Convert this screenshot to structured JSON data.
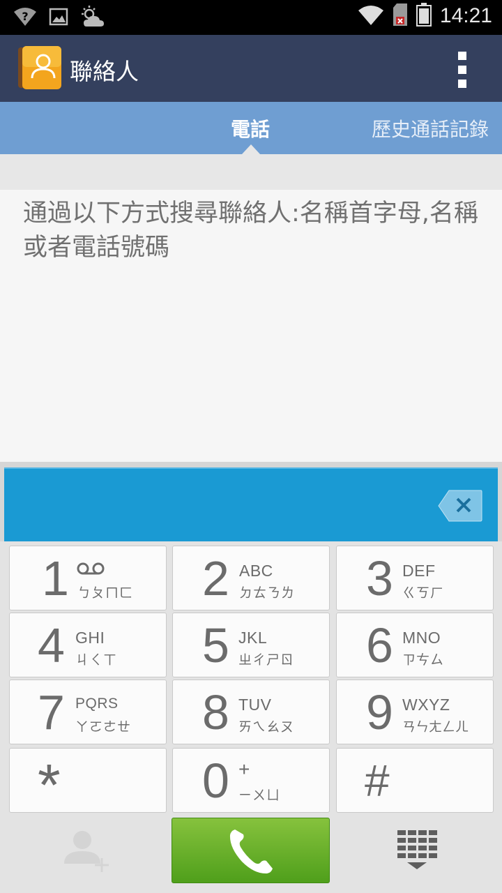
{
  "status_bar": {
    "time": "14:21",
    "icons": [
      "wifi-unknown-icon",
      "image-icon",
      "weather-icon",
      "wifi-icon",
      "sim-missing-icon",
      "battery-icon"
    ]
  },
  "action_bar": {
    "title": "聯絡人",
    "icon": "contacts-book-icon",
    "menu_icon": "overflow-menu-icon"
  },
  "tabs": [
    {
      "label": "電話",
      "active": true
    },
    {
      "label": "歷史通話記錄",
      "active": false
    }
  ],
  "search_hint": "通過以下方式搜尋聯絡人:名稱首字母,名稱或者電話號碼",
  "keypad": {
    "keys": [
      {
        "digit": "1",
        "letters": "",
        "bopomofo": "ㄅㄆㄇㄈ"
      },
      {
        "digit": "2",
        "letters": "ABC",
        "bopomofo": "ㄉㄊㄋㄌ"
      },
      {
        "digit": "3",
        "letters": "DEF",
        "bopomofo": "ㄍㄎㄏ"
      },
      {
        "digit": "4",
        "letters": "GHI",
        "bopomofo": "ㄐㄑㄒ"
      },
      {
        "digit": "5",
        "letters": "JKL",
        "bopomofo": "ㄓㄔㄕㄖ"
      },
      {
        "digit": "6",
        "letters": "MNO",
        "bopomofo": "ㄗㄘㄙ"
      },
      {
        "digit": "7",
        "letters": "PQRS",
        "bopomofo": "ㄚㄛㄜㄝ"
      },
      {
        "digit": "8",
        "letters": "TUV",
        "bopomofo": "ㄞㄟㄠㄡ"
      },
      {
        "digit": "9",
        "letters": "WXYZ",
        "bopomofo": "ㄢㄣㄤㄥㄦ"
      },
      {
        "digit": "*",
        "letters": "",
        "bopomofo": ""
      },
      {
        "digit": "0",
        "letters": "+",
        "bopomofo": "ㄧㄨㄩ"
      },
      {
        "digit": "#",
        "letters": "",
        "bopomofo": ""
      }
    ]
  },
  "colors": {
    "action_bar": "#34405e",
    "tab_bar": "#6f9ed2",
    "digits_bar": "#1a9ad3",
    "call_button": "#6cb52e"
  }
}
